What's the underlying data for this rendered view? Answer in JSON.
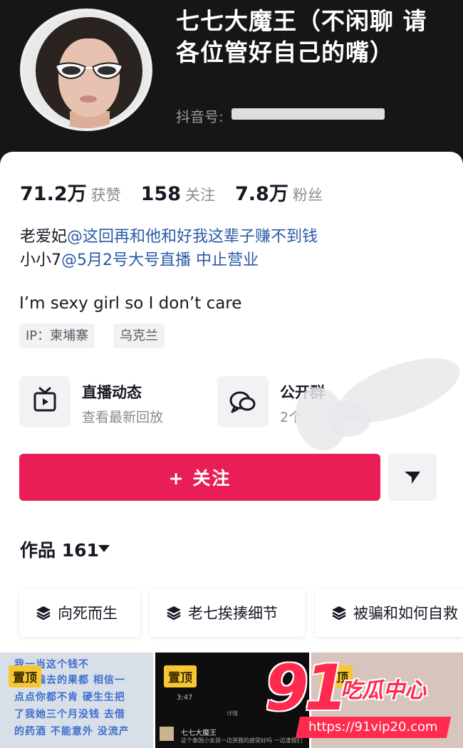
{
  "profile": {
    "nickname": "七七大魔王（不闲聊 请各位管好自己的嘴）",
    "douyin_id_label": "抖音号:"
  },
  "stats": [
    {
      "value": "71.2万",
      "label": "获赞"
    },
    {
      "value": "158",
      "label": "关注"
    },
    {
      "value": "7.8万",
      "label": "粉丝"
    }
  ],
  "bio": {
    "line1_prefix": "老爱妃",
    "line1_mention": "@这回再和他和好我这辈子赚不到钱",
    "line2_prefix": "小小7",
    "line2_mention": "@5月2号大号直播 中止营业",
    "english": "I’m sexy girl so I don’t care"
  },
  "tags": {
    "ip": "IP：柬埔寨",
    "location": "乌克兰"
  },
  "features": {
    "live": {
      "title": "直播动态",
      "subtitle": "查看最新回放",
      "icon": "tv-icon"
    },
    "group": {
      "title": "公开群",
      "subtitle": "2个",
      "icon": "chat-bubbles-icon"
    }
  },
  "actions": {
    "follow_label": "+ 关注",
    "more_icon": "triangle-down-icon"
  },
  "works": {
    "title": "作品 161",
    "collections": [
      "向死而生",
      "老七挨揍细节",
      "被骗和如何自救"
    ]
  },
  "thumbnails": [
    {
      "pin": "置顶",
      "overlay": [
        "我一当这个钱不",
        "身体骗去的果都 相信一",
        "点点你都不肯 硬生生把",
        "了我她三个月没钱 去借",
        "的药酒 不能意外 没流产"
      ]
    },
    {
      "pin": "置顶",
      "time": "3:47",
      "detail": "详情",
      "name": "七七大魔王",
      "caption": "这个泰国小女孩一边哭我的感受好吗 一边渣我们"
    },
    {
      "pin": "置顶"
    }
  ],
  "watermark": {
    "number": "91",
    "text": "吃瓜中心",
    "url": "https://91vip20.com"
  },
  "colors": {
    "accent": "#ea1e56",
    "mention": "#2a5aa8",
    "watermark": "#ff2b4e",
    "pin": "#f7c733"
  }
}
